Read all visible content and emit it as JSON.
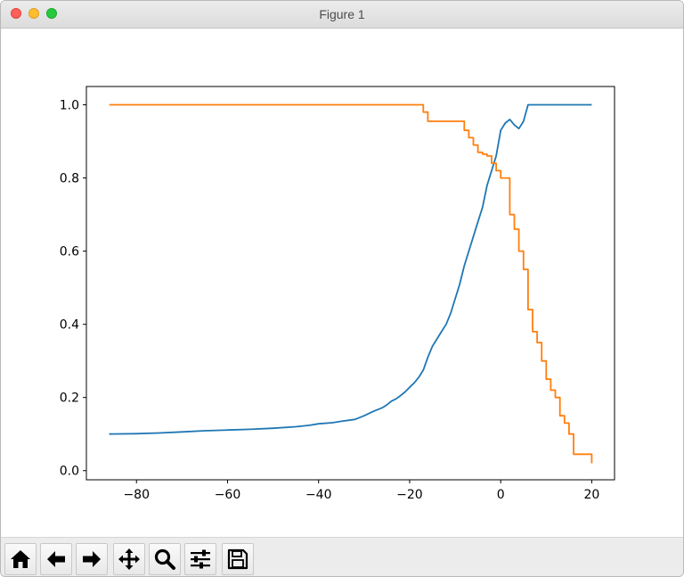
{
  "window": {
    "title": "Figure 1"
  },
  "toolbar": {
    "buttons": [
      {
        "icon": "home-icon",
        "action": "home"
      },
      {
        "icon": "back-arrow-icon",
        "action": "back"
      },
      {
        "icon": "forward-arrow-icon",
        "action": "forward"
      },
      {
        "icon": "pan-move-icon",
        "action": "pan"
      },
      {
        "icon": "zoom-magnifier-icon",
        "action": "zoom"
      },
      {
        "icon": "subplots-sliders-icon",
        "action": "configure-subplots"
      },
      {
        "icon": "save-floppy-icon",
        "action": "save"
      }
    ]
  },
  "chart_data": {
    "type": "line",
    "title": "",
    "xlabel": "",
    "ylabel": "",
    "xlim": [
      -91,
      25
    ],
    "ylim": [
      -0.025,
      1.05
    ],
    "xticks": [
      -80,
      -60,
      -40,
      -20,
      0,
      20
    ],
    "xtick_labels": [
      "−80",
      "−60",
      "−40",
      "−20",
      "0",
      "20"
    ],
    "yticks": [
      0.0,
      0.2,
      0.4,
      0.6,
      0.8,
      1.0
    ],
    "ytick_labels": [
      "0.0",
      "0.2",
      "0.4",
      "0.6",
      "0.8",
      "1.0"
    ],
    "grid": false,
    "legend": "none",
    "colors": {
      "series_1": "#1f77b4",
      "series_2": "#ff7f0e"
    },
    "series": [
      {
        "step": false,
        "x": [
          -86,
          -80,
          -75,
          -70,
          -65,
          -60,
          -55,
          -50,
          -45,
          -42,
          -40,
          -37,
          -35,
          -32,
          -30,
          -28,
          -26,
          -25,
          -24,
          -23,
          -22,
          -21,
          -20,
          -19,
          -18,
          -17,
          -16,
          -15,
          -14,
          -13,
          -12,
          -11,
          -10,
          -9,
          -8,
          -7,
          -6,
          -5,
          -4,
          -3,
          -2,
          -1,
          0,
          1,
          2,
          3,
          4,
          5,
          6,
          7,
          8,
          9,
          10,
          12,
          14,
          16,
          18,
          20
        ],
        "y": [
          0.1,
          0.101,
          0.103,
          0.106,
          0.109,
          0.111,
          0.113,
          0.116,
          0.12,
          0.124,
          0.128,
          0.131,
          0.135,
          0.14,
          0.15,
          0.162,
          0.172,
          0.18,
          0.19,
          0.196,
          0.205,
          0.215,
          0.228,
          0.24,
          0.255,
          0.275,
          0.31,
          0.34,
          0.36,
          0.38,
          0.4,
          0.43,
          0.47,
          0.51,
          0.56,
          0.6,
          0.64,
          0.68,
          0.72,
          0.78,
          0.82,
          0.86,
          0.93,
          0.95,
          0.96,
          0.945,
          0.935,
          0.955,
          1.0,
          1.0,
          1.0,
          1.0,
          1.0,
          1.0,
          1.0,
          1.0,
          1.0,
          1.0
        ]
      },
      {
        "step": true,
        "x": [
          -86,
          -17,
          -16,
          -15,
          -8,
          -7,
          -6,
          -5,
          -4,
          -3,
          -2,
          -1,
          0,
          1,
          2,
          3,
          4,
          5,
          6,
          7,
          8,
          9,
          10,
          11,
          12,
          13,
          14,
          15,
          16,
          17,
          18,
          19,
          20
        ],
        "y": [
          1.0,
          0.98,
          0.955,
          0.955,
          0.93,
          0.91,
          0.89,
          0.87,
          0.865,
          0.86,
          0.84,
          0.82,
          0.8,
          0.8,
          0.7,
          0.66,
          0.6,
          0.55,
          0.44,
          0.38,
          0.35,
          0.3,
          0.25,
          0.22,
          0.2,
          0.15,
          0.13,
          0.1,
          0.045,
          0.045,
          0.045,
          0.045,
          0.02
        ]
      }
    ]
  }
}
